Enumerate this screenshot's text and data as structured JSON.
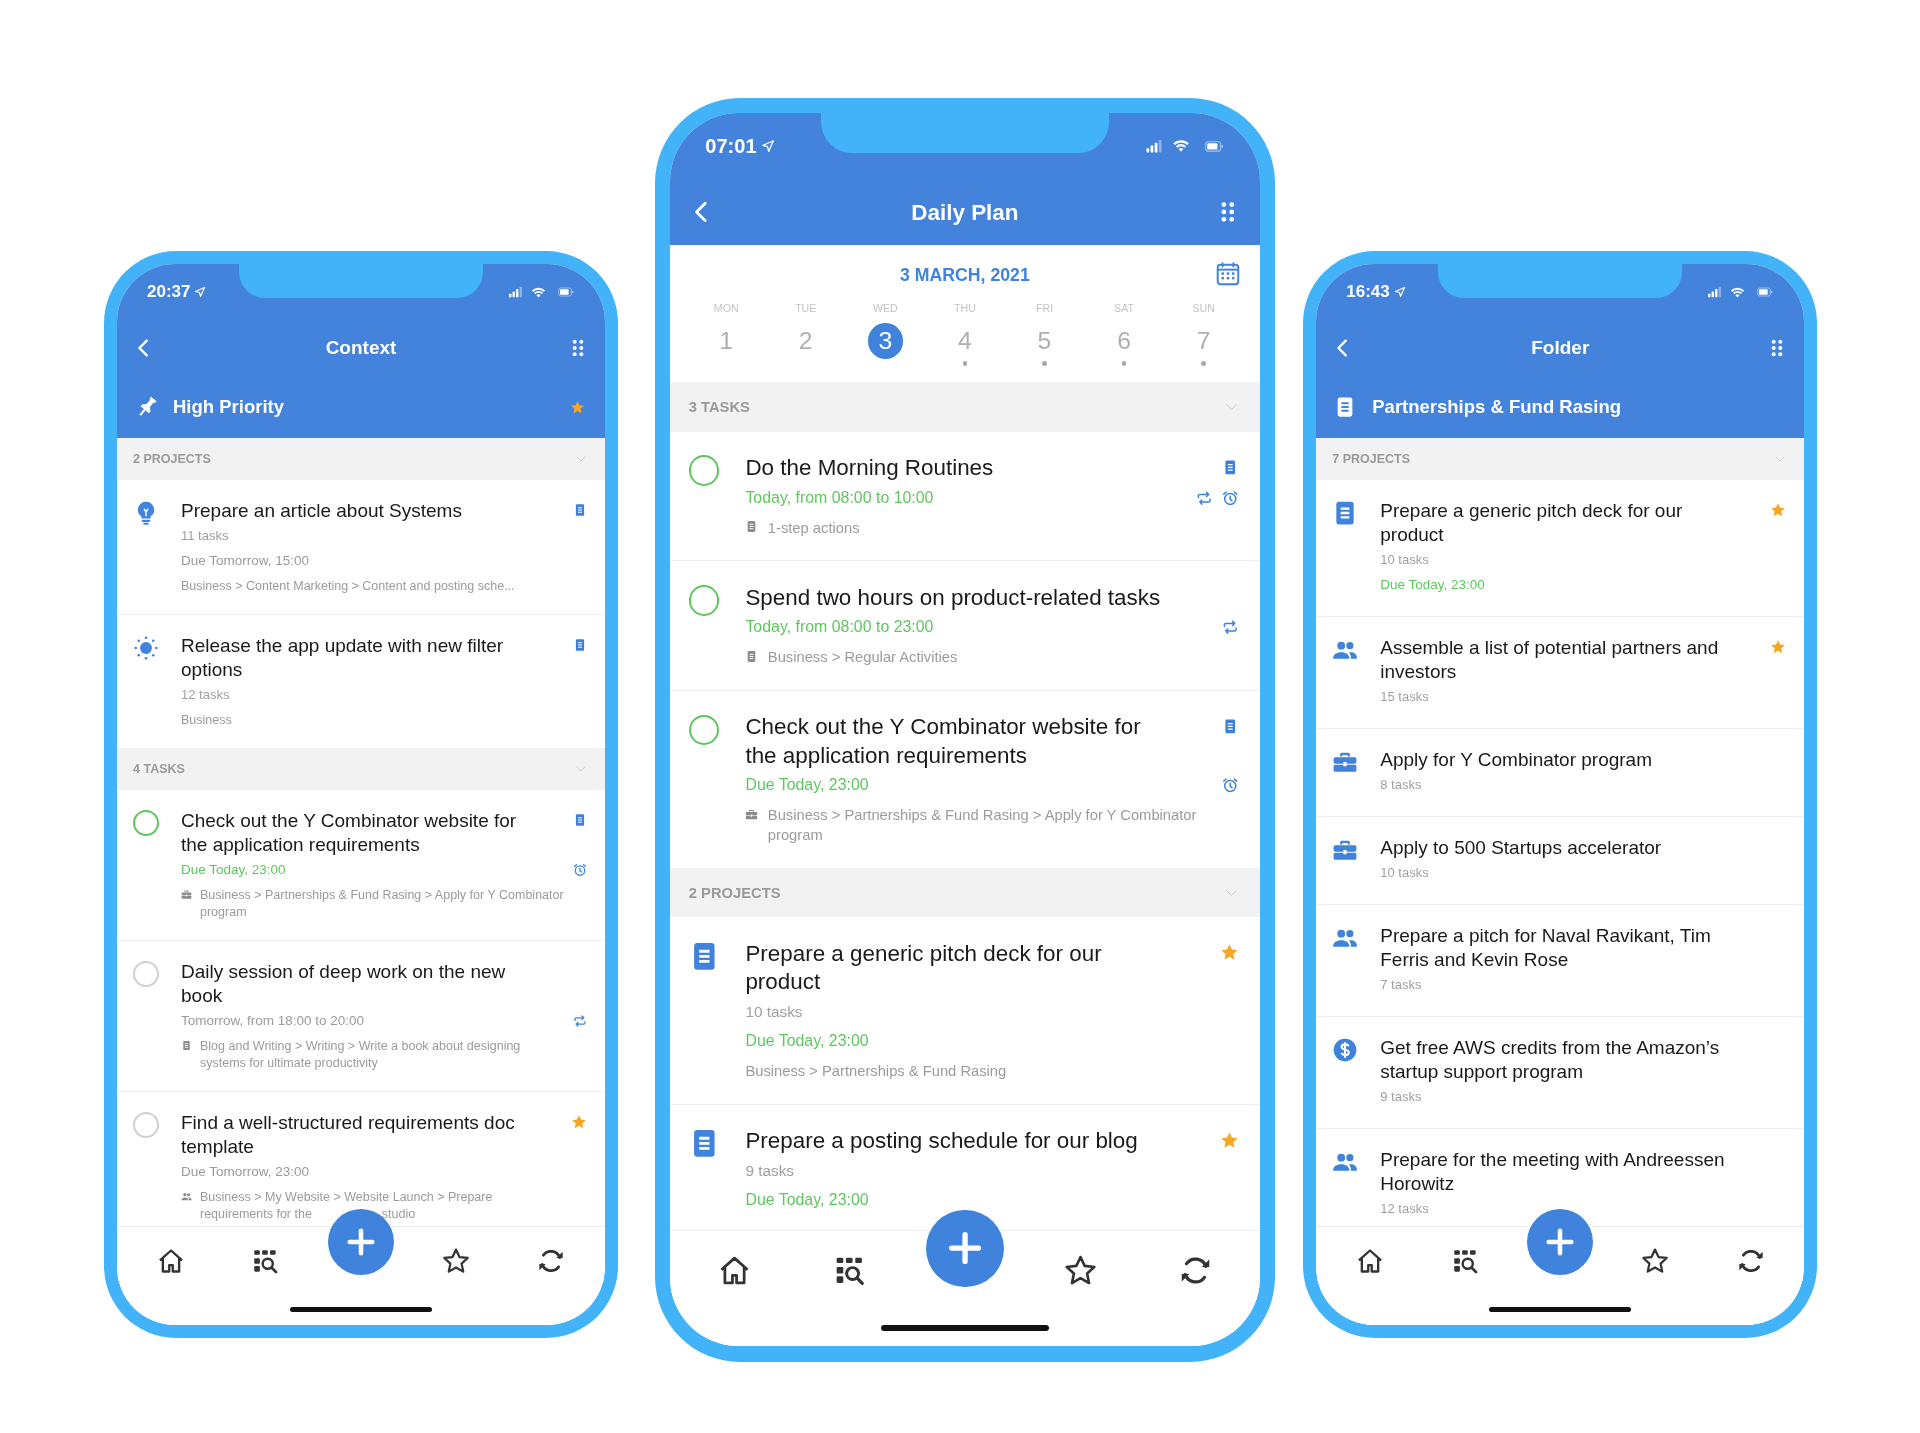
{
  "phones": [
    {
      "time": "20:37",
      "title": "Context",
      "header": {
        "label": "High Priority",
        "starred": true
      },
      "sections": [
        {
          "label": "2 PROJECTS",
          "items": [
            {
              "kind": "project",
              "title": "Prepare an article about Systems",
              "has_note": true,
              "starred": false,
              "lines": [
                {
                  "kind": "count",
                  "text": "11 tasks"
                },
                {
                  "kind": "date",
                  "text": "Due Tomorrow, 15:00",
                  "highlight": false,
                  "repeating": false,
                  "reminder": false
                },
                {
                  "kind": "path",
                  "text": "Business > Content Marketing > Content and posting sche..."
                }
              ]
            },
            {
              "kind": "project",
              "title": "Release the app update with new filter options",
              "has_note": true,
              "starred": false,
              "lines": [
                {
                  "kind": "count",
                  "text": "12 tasks"
                },
                {
                  "kind": "path",
                  "text": "Business"
                }
              ]
            }
          ]
        },
        {
          "label": "4 TASKS",
          "items": [
            {
              "kind": "task",
              "checked": false,
              "title": "Check out the Y Combinator website for the application requirements",
              "has_note": true,
              "starred": false,
              "lines": [
                {
                  "kind": "date",
                  "text": "Due Today, 23:00",
                  "highlight": true,
                  "repeating": false,
                  "reminder": true
                },
                {
                  "kind": "path",
                  "text": "Business > Partnerships & Fund Rasing > Apply for Y Combinator program"
                }
              ]
            },
            {
              "kind": "task",
              "checked": false,
              "title": "Daily session of deep work on the new book",
              "has_note": false,
              "starred": false,
              "lines": [
                {
                  "kind": "date",
                  "text": "Tomorrow, from 18:00 to 20:00",
                  "highlight": false,
                  "repeating": true,
                  "reminder": false
                },
                {
                  "kind": "path",
                  "text": "Blog and Writing > Writing > Write a book about designing systems for ultimate productivity"
                }
              ]
            },
            {
              "kind": "task",
              "checked": false,
              "title": "Find a well-structured requirements doc template",
              "has_note": false,
              "starred": true,
              "lines": [
                {
                  "kind": "date",
                  "text": "Due Tomorrow, 23:00",
                  "highlight": false,
                  "repeating": false,
                  "reminder": false
                },
                {
                  "kind": "path",
                  "text": "Business > My Website > Website Launch > Prepare requirements for the",
                  "tail": "studio"
                }
              ]
            }
          ]
        }
      ]
    },
    {
      "time": "07:01",
      "title": "Daily Plan",
      "calendar": {
        "date": "3 MARCH, 2021",
        "days": [
          {
            "weekday": "MON",
            "day": "1",
            "selected": false,
            "marked": false
          },
          {
            "weekday": "TUE",
            "day": "2",
            "selected": false,
            "marked": false
          },
          {
            "weekday": "WED",
            "day": "3",
            "selected": true,
            "marked": false
          },
          {
            "weekday": "THU",
            "day": "4",
            "selected": false,
            "marked": true
          },
          {
            "weekday": "FRI",
            "day": "5",
            "selected": false,
            "marked": true
          },
          {
            "weekday": "SAT",
            "day": "6",
            "selected": false,
            "marked": true
          },
          {
            "weekday": "SUN",
            "day": "7",
            "selected": false,
            "marked": true
          }
        ]
      },
      "sections": [
        {
          "label": "3 TASKS",
          "items": [
            {
              "kind": "task",
              "checked": false,
              "title": "Do the Morning Routines",
              "has_note": true,
              "starred": false,
              "lines": [
                {
                  "kind": "date",
                  "text": "Today, from 08:00 to 10:00",
                  "highlight": true,
                  "repeating": true,
                  "reminder": true
                },
                {
                  "kind": "path",
                  "text": "1-step actions"
                }
              ]
            },
            {
              "kind": "task",
              "checked": false,
              "title": "Spend two hours on product-related tasks",
              "has_note": false,
              "starred": false,
              "lines": [
                {
                  "kind": "date",
                  "text": "Today, from 08:00 to 23:00",
                  "highlight": true,
                  "repeating": true,
                  "reminder": false
                },
                {
                  "kind": "path",
                  "text": "Business > Regular Activities"
                }
              ]
            },
            {
              "kind": "task",
              "checked": false,
              "title": "Check out the Y Combinator website for the application requirements",
              "has_note": true,
              "starred": false,
              "lines": [
                {
                  "kind": "date",
                  "text": "Due Today, 23:00",
                  "highlight": true,
                  "repeating": false,
                  "reminder": true
                },
                {
                  "kind": "path",
                  "text": "Business > Partnerships & Fund Rasing > Apply for Y Combinator program"
                }
              ]
            }
          ]
        },
        {
          "label": "2 PROJECTS",
          "items": [
            {
              "kind": "project",
              "title": "Prepare a generic pitch deck for our product",
              "has_note": false,
              "starred": true,
              "lines": [
                {
                  "kind": "count",
                  "text": "10 tasks"
                },
                {
                  "kind": "date",
                  "text": "Due Today, 23:00",
                  "highlight": true,
                  "repeating": false,
                  "reminder": false
                },
                {
                  "kind": "path",
                  "text": "Business > Partnerships & Fund Rasing"
                }
              ]
            },
            {
              "kind": "project",
              "title": "Prepare a posting schedule for our blog",
              "has_note": false,
              "starred": true,
              "lines": [
                {
                  "kind": "count",
                  "text": "9 tasks"
                },
                {
                  "kind": "date",
                  "text": "Due Today, 23:00",
                  "highlight": true,
                  "repeating": false,
                  "reminder": false
                }
              ]
            }
          ]
        }
      ]
    },
    {
      "time": "16:43",
      "title": "Folder",
      "header": {
        "label": "Partnerships & Fund Rasing",
        "starred": false
      },
      "sections": [
        {
          "label": "7 PROJECTS",
          "items": [
            {
              "kind": "project",
              "title": "Prepare a generic pitch deck for our product",
              "has_note": false,
              "starred": true,
              "lines": [
                {
                  "kind": "count",
                  "text": "10 tasks"
                },
                {
                  "kind": "date",
                  "text": "Due Today, 23:00",
                  "highlight": true,
                  "repeating": false,
                  "reminder": false
                }
              ]
            },
            {
              "kind": "project",
              "title": "Assemble a list of potential partners and investors",
              "has_note": false,
              "starred": true,
              "lines": [
                {
                  "kind": "count",
                  "text": "15 tasks"
                }
              ]
            },
            {
              "kind": "project",
              "title": "Apply for Y Combinator program",
              "has_note": false,
              "starred": false,
              "lines": [
                {
                  "kind": "count",
                  "text": "8 tasks"
                }
              ]
            },
            {
              "kind": "project",
              "title": "Apply to 500 Startups accelerator",
              "has_note": false,
              "starred": false,
              "lines": [
                {
                  "kind": "count",
                  "text": "10 tasks"
                }
              ]
            },
            {
              "kind": "project",
              "title": "Prepare a pitch for Naval Ravikant, Tim Ferris and Kevin Rose",
              "has_note": false,
              "starred": false,
              "lines": [
                {
                  "kind": "count",
                  "text": "7 tasks"
                }
              ]
            },
            {
              "kind": "project",
              "title": "Get free AWS credits from the Amazon’s startup support program",
              "has_note": false,
              "starred": false,
              "lines": [
                {
                  "kind": "count",
                  "text": "9 tasks"
                }
              ]
            },
            {
              "kind": "project",
              "title": "Prepare for the meeting with Andreessen Horowitz",
              "has_note": false,
              "starred": false,
              "lines": [
                {
                  "kind": "count",
                  "text": "12 tasks"
                }
              ]
            }
          ]
        }
      ]
    }
  ]
}
